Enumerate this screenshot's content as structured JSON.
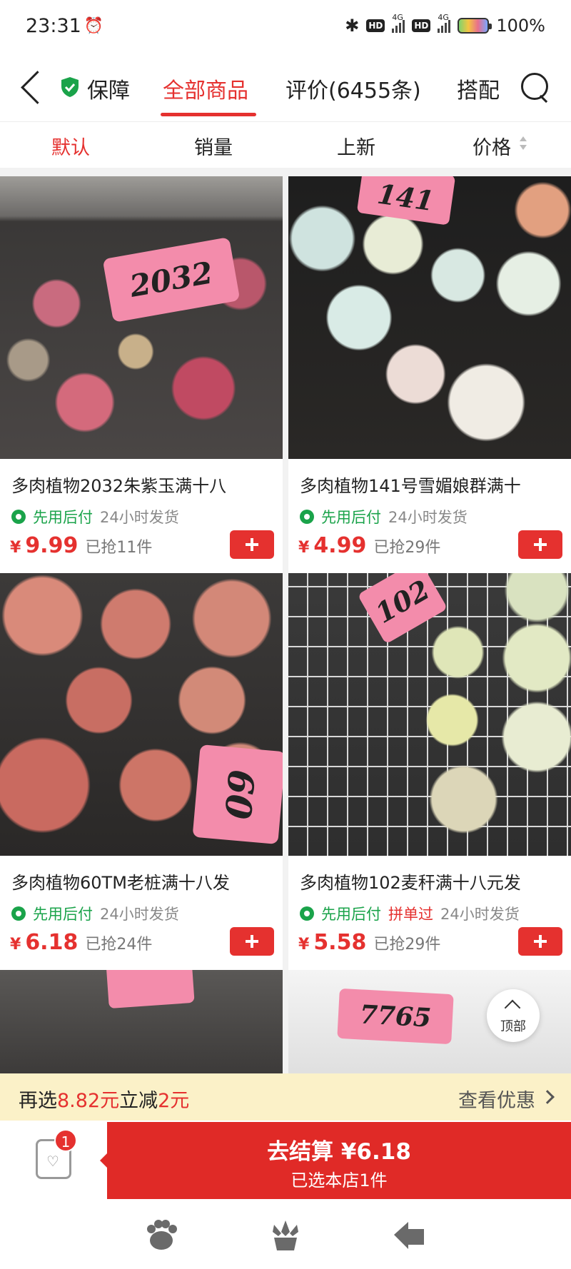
{
  "status_bar": {
    "time": "23:31",
    "battery": "100%",
    "network": "4G",
    "hd": "HD"
  },
  "nav": {
    "guarantee": "保障",
    "tabs": [
      {
        "label": "全部商品",
        "active": true
      },
      {
        "label": "评价(6455条)",
        "active": false
      },
      {
        "label": "搭配",
        "active": false
      }
    ]
  },
  "sort": [
    {
      "label": "默认",
      "active": true
    },
    {
      "label": "销量",
      "active": false
    },
    {
      "label": "上新",
      "active": false
    },
    {
      "label": "价格",
      "active": false
    }
  ],
  "products": [
    {
      "title": "多肉植物2032朱紫玉满十八",
      "paylater": "先用后付",
      "group": "",
      "ship": "24小时发货",
      "yen": "¥",
      "price": "9.99",
      "sold": "已抢11件",
      "tag": "2032"
    },
    {
      "title": "多肉植物141号雪媚娘群满十",
      "paylater": "先用后付",
      "group": "",
      "ship": "24小时发货",
      "yen": "¥",
      "price": "4.99",
      "sold": "已抢29件",
      "tag": "141"
    },
    {
      "title": "多肉植物60TM老桩满十八发",
      "paylater": "先用后付",
      "group": "",
      "ship": "24小时发货",
      "yen": "¥",
      "price": "6.18",
      "sold": "已抢24件",
      "tag": "60"
    },
    {
      "title": "多肉植物102麦秆满十八元发",
      "paylater": "先用后付",
      "group": "拼单过",
      "ship": "24小时发货",
      "yen": "¥",
      "price": "5.58",
      "sold": "已抢29件",
      "tag": "102"
    },
    {
      "title": "",
      "tag": ""
    },
    {
      "title": "",
      "tag": "7765"
    }
  ],
  "back_to_top": "顶部",
  "promo": {
    "pre": "再选",
    "amount": "8.82元",
    "mid": "立减",
    "discount": "2元",
    "link": "查看优惠"
  },
  "cart": {
    "badge": "1"
  },
  "checkout": {
    "main": "去结算 ¥6.18",
    "sub": "已选本店1件"
  },
  "colors": {
    "accent": "#e5312f",
    "green": "#1aa34a",
    "promo_bg": "#fbf1c8"
  }
}
